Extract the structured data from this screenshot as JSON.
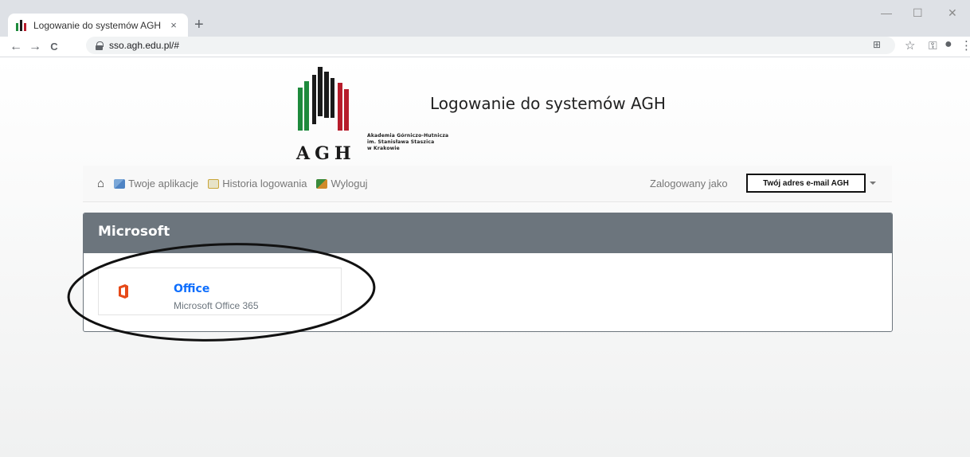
{
  "browser": {
    "tab_title": "Logowanie do systemów AGH",
    "tab_close": "×",
    "new_tab": "+",
    "url": "sso.agh.edu.pl/#",
    "window_controls": {
      "minimize": "—",
      "maximize": "☐",
      "close": "✕"
    },
    "nav": {
      "back": "←",
      "forward": "→",
      "reload": "C"
    },
    "toolbar_icons": {
      "translate": "⊞",
      "star": "☆",
      "key": "⚿",
      "account": "●",
      "menu": "⋮"
    }
  },
  "header": {
    "title": "Logowanie do systemów AGH",
    "logo_text": "AGH",
    "university_lines": [
      "Akademia Górniczo-Hutnicza",
      "im. Stanisława Staszica",
      "w Krakowie"
    ]
  },
  "navbar": {
    "home_icon": "home-icon",
    "links": [
      {
        "label": "Twoje aplikacje",
        "icon": "apps-icon"
      },
      {
        "label": "Historia logowania",
        "icon": "calendar-icon"
      },
      {
        "label": "Wyloguj",
        "icon": "logout-icon"
      }
    ],
    "logged_as": "Zalogowany jako",
    "email": "Twój adres e-mail AGH"
  },
  "panel": {
    "heading": "Microsoft",
    "apps": [
      {
        "name": "Office",
        "description": "Microsoft Office 365",
        "icon": "office-icon"
      }
    ]
  },
  "colors": {
    "panel_header": "#6c757d",
    "link": "#0d6efd",
    "agh_green": "#1e8a3c",
    "agh_black": "#1a1a1a",
    "agh_red": "#b71c2b",
    "office_orange": "#e64a19"
  }
}
